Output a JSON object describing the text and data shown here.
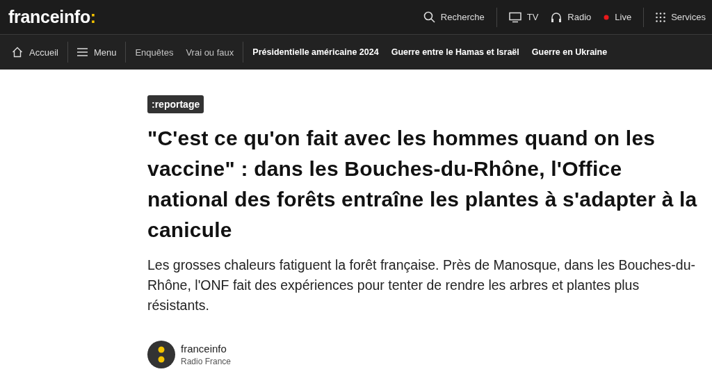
{
  "header": {
    "logo": {
      "name": "franceinfo",
      "mark": ":"
    },
    "links": [
      {
        "kind": "search",
        "label": "Recherche"
      },
      {
        "kind": "tv",
        "label": "TV"
      },
      {
        "kind": "radio",
        "label": "Radio"
      },
      {
        "kind": "live",
        "label": "Live"
      },
      {
        "kind": "services",
        "label": "Services"
      }
    ]
  },
  "nav": {
    "groups": [
      {
        "items": [
          {
            "kind": "home",
            "label": "Accueil"
          }
        ]
      },
      {
        "items": [
          {
            "kind": "menu",
            "label": "Menu"
          }
        ]
      },
      {
        "items": [
          {
            "kind": "link",
            "label": "Enquêtes"
          },
          {
            "kind": "link",
            "label": "Vrai ou faux"
          }
        ]
      },
      {
        "items": [
          {
            "kind": "topic",
            "label": "Présidentielle américaine 2024"
          },
          {
            "kind": "topic",
            "label": "Guerre entre le Hamas et Israël"
          },
          {
            "kind": "topic",
            "label": "Guerre en Ukraine"
          }
        ]
      }
    ]
  },
  "article": {
    "tag": ":reportage",
    "title": "\"C'est ce qu'on fait avec les hommes quand on les vaccine\" : dans les Bouches-du-Rhône, l'Office national des forêts entraîne les plantes à s'adapter à la canicule",
    "lead": "Les grosses chaleurs fatiguent la forêt française. Près de Manosque, dans les Bouches-du-Rhône, l'ONF fait des expériences pour tenter de rendre les arbres et plantes plus résistants.",
    "author": {
      "name": "franceinfo",
      "organization": "Radio France"
    }
  }
}
